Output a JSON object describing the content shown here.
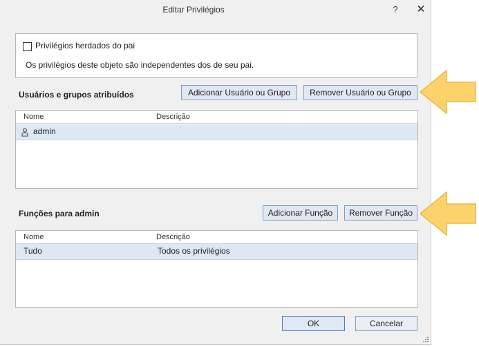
{
  "dialog": {
    "title": "Editar Privilégios",
    "help_glyph": "?",
    "close_glyph": "✕"
  },
  "inherit": {
    "checkbox_label": "Privilégios herdados do pai",
    "checked": false,
    "description": "Os privilégios deste objeto são independentes dos de seu pai."
  },
  "users": {
    "section_label": "Usuários e grupos atribuídos",
    "add_button": "Adicionar Usuário ou Grupo",
    "remove_button": "Remover Usuário ou Grupo",
    "columns": [
      "Nome",
      "Descrição"
    ],
    "rows": [
      {
        "name": "admin",
        "description": "",
        "icon": "user-icon"
      }
    ]
  },
  "roles": {
    "section_label": "Funções para admin",
    "add_button": "Adicionar Função",
    "remove_button": "Remover Função",
    "columns": [
      "Nome",
      "Descrição"
    ],
    "rows": [
      {
        "name": "Tudo",
        "description": "Todos os privilégios"
      }
    ]
  },
  "footer": {
    "ok": "OK",
    "cancel": "Cancelar"
  },
  "colors": {
    "accent_arrow": "#fbd36a",
    "selection": "#dde8f5"
  }
}
